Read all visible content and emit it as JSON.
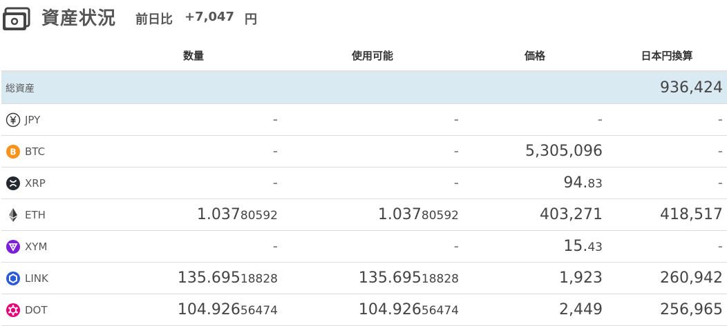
{
  "header": {
    "title": "資産状況",
    "diff_label": "前日比",
    "diff_value": "+7,047",
    "diff_unit": "円"
  },
  "columns": {
    "name": "",
    "quantity": "数量",
    "available": "使用可能",
    "price": "価格",
    "jpy": "日本円換算"
  },
  "total": {
    "label": "総資産",
    "jpy": "936,424"
  },
  "rows": [
    {
      "symbol": "JPY",
      "icon": "yen-icon",
      "quantity": {
        "main": "-",
        "small": ""
      },
      "available": {
        "main": "-",
        "small": ""
      },
      "price": {
        "main": "-",
        "small": ""
      },
      "jpy": "-"
    },
    {
      "symbol": "BTC",
      "icon": "bitcoin-icon",
      "quantity": {
        "main": "-",
        "small": ""
      },
      "available": {
        "main": "-",
        "small": ""
      },
      "price": {
        "main": "5,305,096",
        "small": ""
      },
      "jpy": "-"
    },
    {
      "symbol": "XRP",
      "icon": "xrp-icon",
      "quantity": {
        "main": "-",
        "small": ""
      },
      "available": {
        "main": "-",
        "small": ""
      },
      "price": {
        "main": "94.",
        "small": "83"
      },
      "jpy": "-"
    },
    {
      "symbol": "ETH",
      "icon": "ethereum-icon",
      "quantity": {
        "main": "1.037",
        "small": "80592"
      },
      "available": {
        "main": "1.037",
        "small": "80592"
      },
      "price": {
        "main": "403,271",
        "small": ""
      },
      "jpy": "418,517"
    },
    {
      "symbol": "XYM",
      "icon": "symbol-icon",
      "quantity": {
        "main": "-",
        "small": ""
      },
      "available": {
        "main": "-",
        "small": ""
      },
      "price": {
        "main": "15.",
        "small": "43"
      },
      "jpy": "-"
    },
    {
      "symbol": "LINK",
      "icon": "chainlink-icon",
      "quantity": {
        "main": "135.695",
        "small": "18828"
      },
      "available": {
        "main": "135.695",
        "small": "18828"
      },
      "price": {
        "main": "1,923",
        "small": ""
      },
      "jpy": "260,942"
    },
    {
      "symbol": "DOT",
      "icon": "polkadot-icon",
      "quantity": {
        "main": "104.926",
        "small": "56474"
      },
      "available": {
        "main": "104.926",
        "small": "56474"
      },
      "price": {
        "main": "2,449",
        "small": ""
      },
      "jpy": "256,965"
    }
  ],
  "colors": {
    "total_row_bg": "#daeaf3",
    "btc": "#f7931a",
    "xym": "#7b1fd8",
    "link": "#2a5ada",
    "dot": "#e6007a"
  }
}
